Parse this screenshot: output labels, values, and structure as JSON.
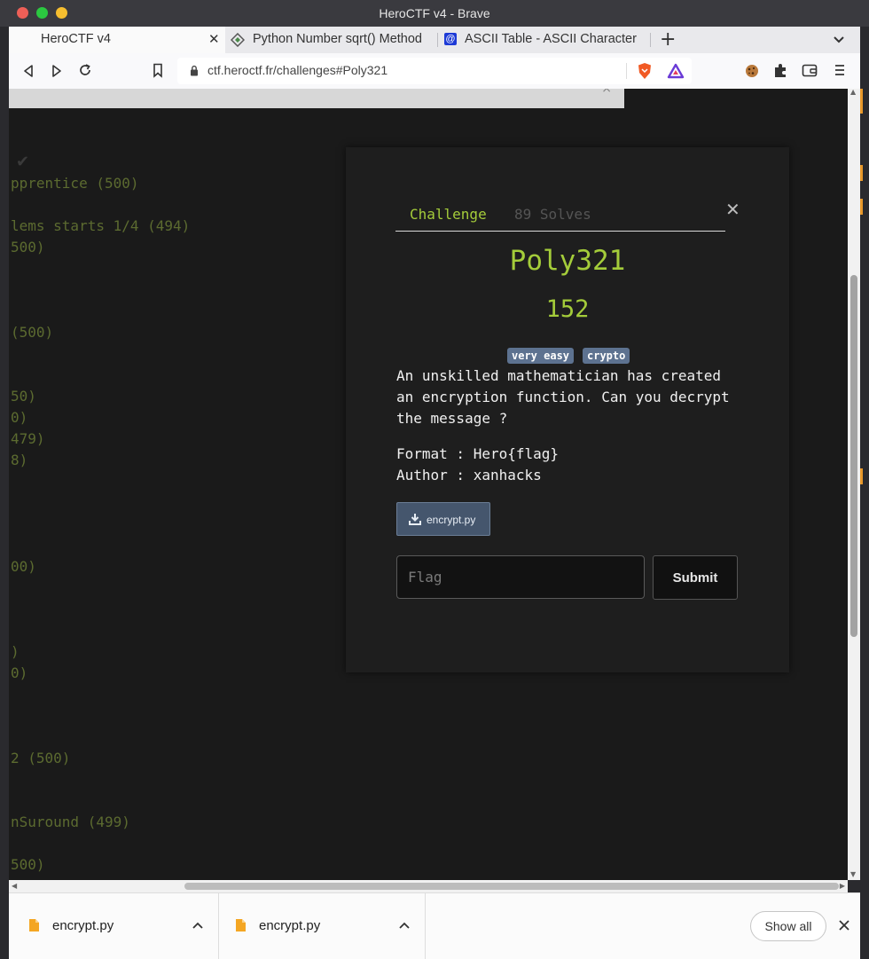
{
  "window": {
    "title": "HeroCTF v4 - Brave"
  },
  "tabs": [
    {
      "label": "HeroCTF v4",
      "active": true
    },
    {
      "label": "Python Number sqrt() Method",
      "active": false
    },
    {
      "label": "ASCII Table - ASCII Character",
      "active": false
    }
  ],
  "toolbar": {
    "url": "ctf.heroctf.fr/challenges#Poly321"
  },
  "background_list": [
    "pprentice (500)",
    "lems starts 1/4 (494)",
    "500)",
    "(500)",
    "50)",
    "0)",
    "479)",
    "8)",
    "00)",
    ")",
    "0)",
    "2 (500)",
    "nSuround (499)",
    "500)"
  ],
  "modal": {
    "tab_challenge": "Challenge",
    "tab_solves": "89 Solves",
    "name": "Poly321",
    "value": "152",
    "tags": [
      "very easy",
      "crypto"
    ],
    "description": "An unskilled mathematician has created an encryption function. Can you decrypt the message ?",
    "format": "Format : Hero{flag}",
    "author": "Author : xanhacks",
    "file": "encrypt.py",
    "flag_placeholder": "Flag",
    "submit_label": "Submit"
  },
  "downloads": {
    "items": [
      "encrypt.py",
      "encrypt.py"
    ],
    "show_all": "Show all"
  },
  "colors": {
    "accent": "#a4cc3a",
    "tag": "#5d7290",
    "background": "#1a1a1a"
  }
}
